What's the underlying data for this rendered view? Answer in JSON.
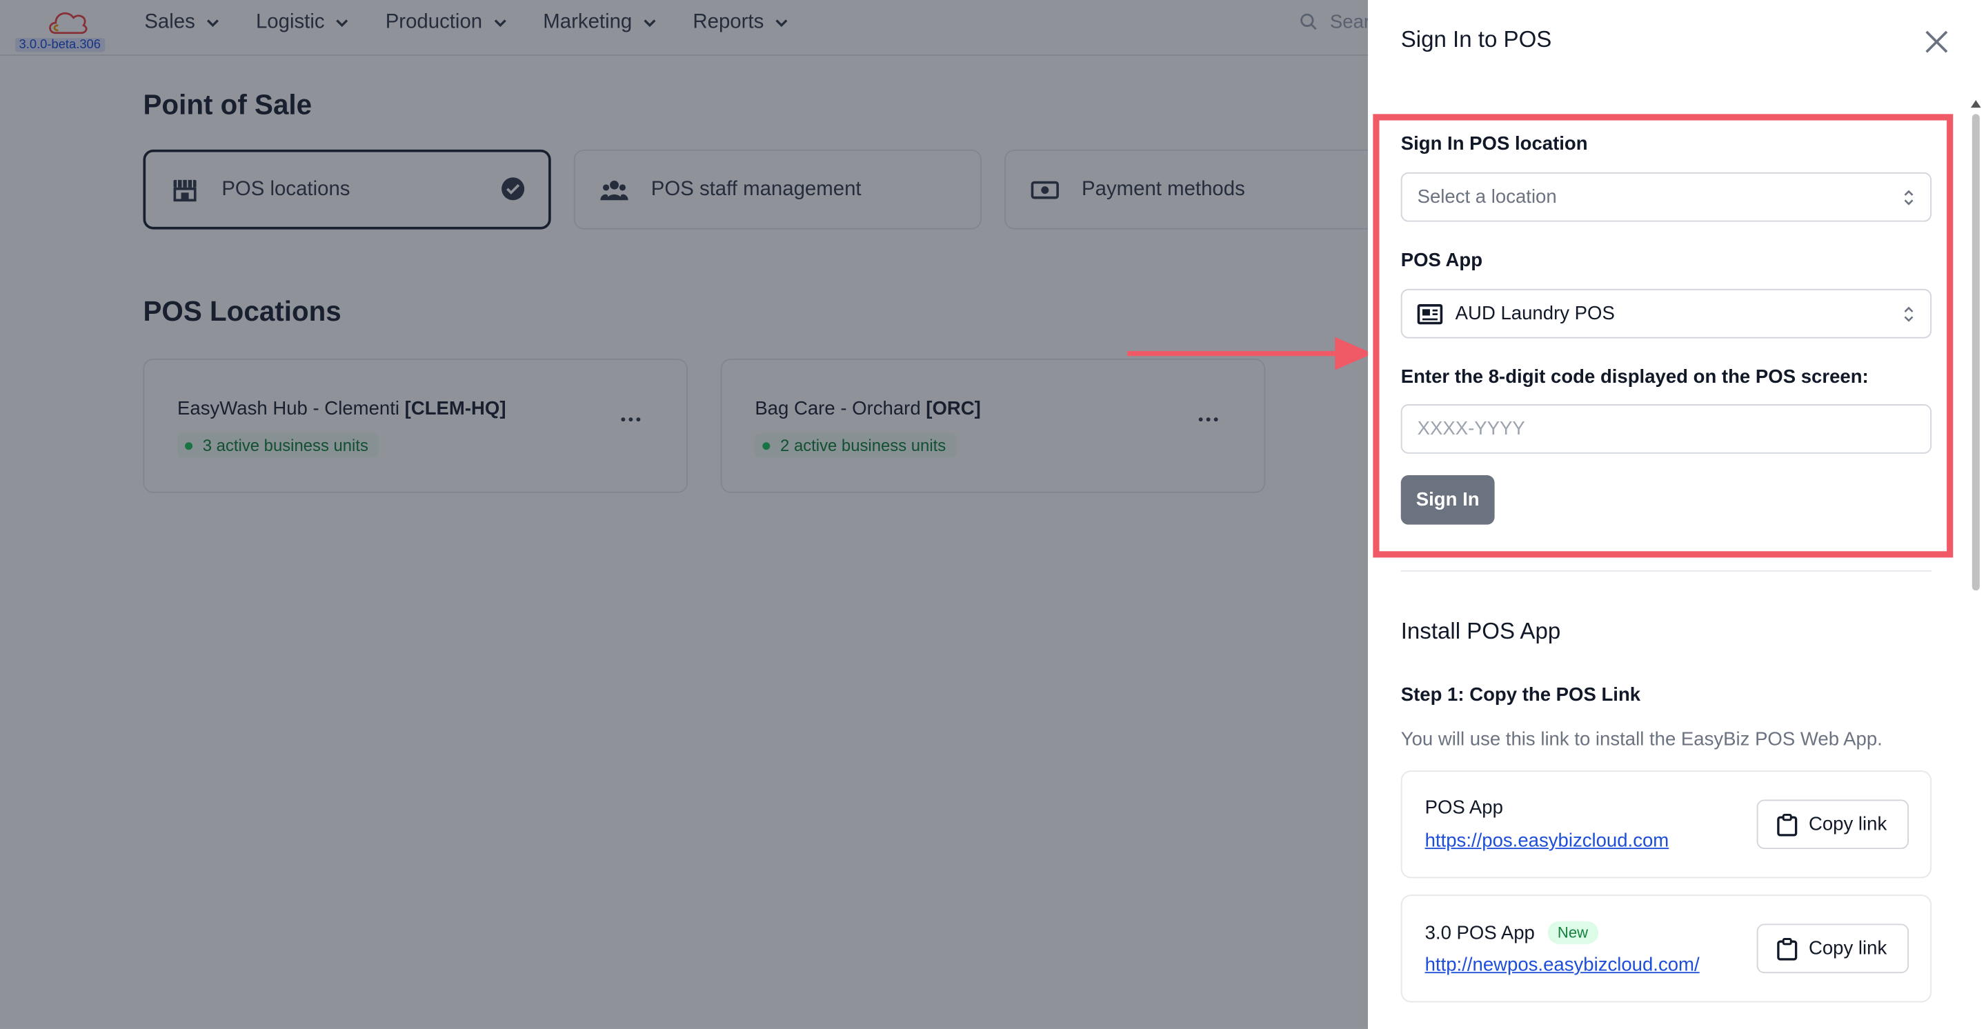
{
  "app": {
    "version": "3.0.0-beta.306",
    "nav": [
      {
        "label": "Sales"
      },
      {
        "label": "Logistic"
      },
      {
        "label": "Production"
      },
      {
        "label": "Marketing"
      },
      {
        "label": "Reports"
      }
    ],
    "search_placeholder": "Sear"
  },
  "page": {
    "title": "Point of Sale",
    "tabs": [
      {
        "label": "POS locations",
        "icon": "store-icon",
        "active": true
      },
      {
        "label": "POS staff management",
        "icon": "users-icon"
      },
      {
        "label": "Payment methods",
        "icon": "cash-icon"
      }
    ],
    "section_title": "POS Locations",
    "locations": [
      {
        "name": "EasyWash Hub - Clementi",
        "code": "[CLEM-HQ]",
        "badge": "3 active business units"
      },
      {
        "name": "Bag Care - Orchard",
        "code": "[ORC]",
        "badge": "2 active business units"
      }
    ]
  },
  "drawer": {
    "title": "Sign In to POS",
    "location_label": "Sign In POS location",
    "location_placeholder": "Select a location",
    "app_label": "POS App",
    "app_value": "AUD Laundry POS",
    "code_label": "Enter the 8-digit code displayed on the POS screen:",
    "code_placeholder": "XXXX-YYYY",
    "signin_label": "Sign In",
    "install_title": "Install POS App",
    "step1_title": "Step 1: Copy the POS Link",
    "step1_desc": "You will use this link to install the EasyBiz POS Web App.",
    "links": [
      {
        "name": "POS App",
        "url": "https://pos.easybizcloud.com",
        "button": "Copy link"
      },
      {
        "name": "3.0 POS App",
        "badge": "New",
        "url": "http://newpos.easybizcloud.com/",
        "button": "Copy link"
      }
    ]
  },
  "colors": {
    "highlight": "#ef5a66",
    "link": "#1d4ed8",
    "overlay": "rgba(17,24,39,0.47)"
  }
}
